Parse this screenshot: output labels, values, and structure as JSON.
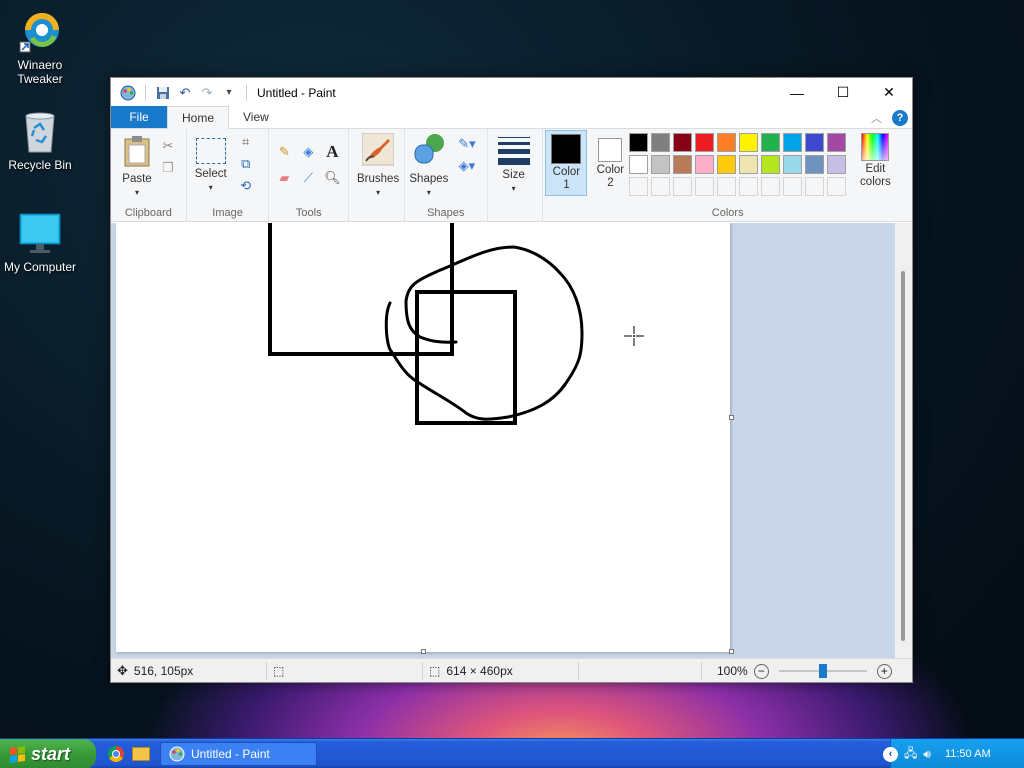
{
  "desktop": {
    "icons": [
      {
        "label": "Winaero Tweaker"
      },
      {
        "label": "Recycle Bin"
      },
      {
        "label": "My Computer"
      }
    ]
  },
  "window": {
    "title": "Untitled - Paint",
    "tabs": [
      "File",
      "Home",
      "View"
    ],
    "active_tab": "Home"
  },
  "ribbon": {
    "groups": {
      "clipboard": "Clipboard",
      "image": "Image",
      "tools": "Tools",
      "shapes": "Shapes",
      "colors": "Colors"
    },
    "paste_label": "Paste",
    "select_label": "Select",
    "brushes_label": "Brushes",
    "shapes_label": "Shapes",
    "size_label": "Size",
    "color1_label": "Color 1",
    "color2_label": "Color 2",
    "edit_colors_label": "Edit colors",
    "color1_value": "#000000",
    "color2_value": "#ffffff",
    "palette_row1": [
      "#000000",
      "#7f7f7f",
      "#880015",
      "#ed1c24",
      "#ff7f27",
      "#fff200",
      "#22b14c",
      "#00a2e8",
      "#3f48cc",
      "#a349a4"
    ],
    "palette_row2": [
      "#ffffff",
      "#c3c3c3",
      "#b97a57",
      "#ffaec9",
      "#ffc90e",
      "#efe4b0",
      "#b5e61d",
      "#99d9ea",
      "#7092be",
      "#c8bfe7"
    ]
  },
  "status": {
    "cursor_pos": "516, 105px",
    "canvas_size": "614 × 460px",
    "zoom": "100%",
    "zoom_level": 0.5
  },
  "taskbar": {
    "start_label": "start",
    "task_label": "Untitled - Paint",
    "clock": "11:50 AM"
  }
}
